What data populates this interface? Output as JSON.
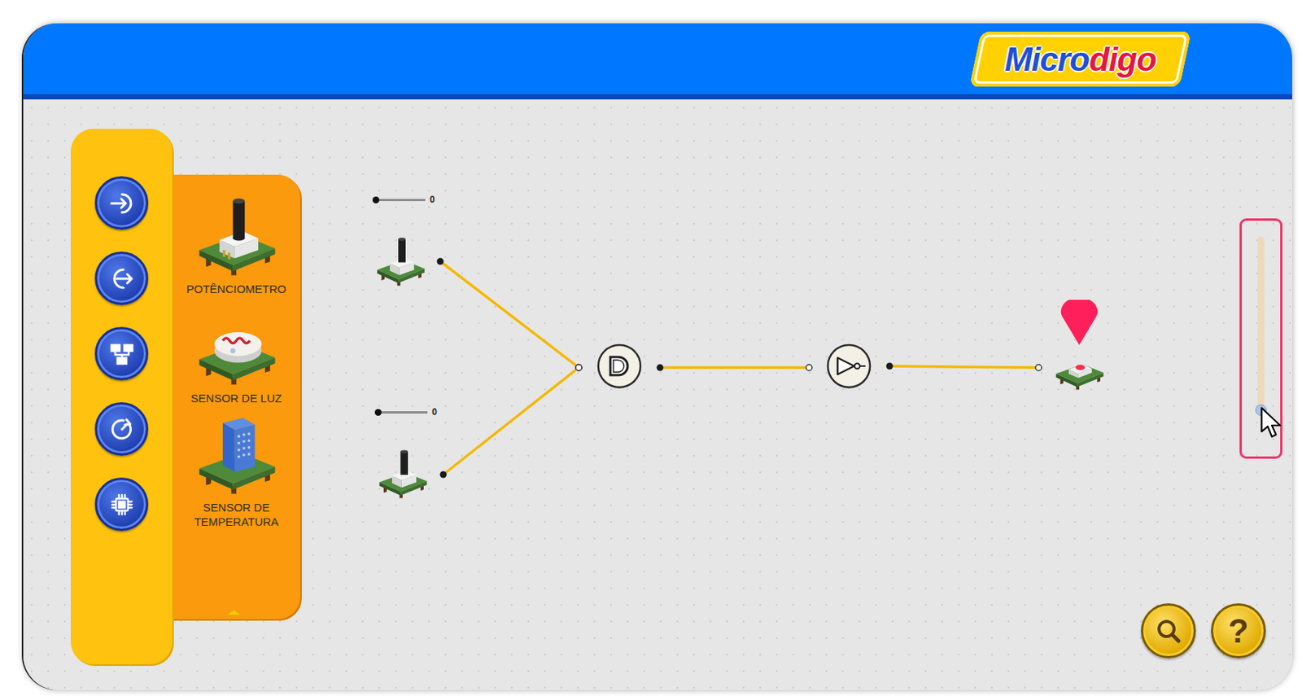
{
  "logo": [
    {
      "text": "Micro",
      "color": "#1f4fd8"
    },
    {
      "text": "digo",
      "color": "#e5173f"
    }
  ],
  "categories": [
    {
      "kind": "input"
    },
    {
      "kind": "output"
    },
    {
      "kind": "logic"
    },
    {
      "kind": "timer"
    },
    {
      "kind": "chip"
    }
  ],
  "palette": [
    {
      "label": "POTÊNCIOMETRO",
      "kind": "potentiometer"
    },
    {
      "label": "SENSOR DE LUZ",
      "kind": "light"
    },
    {
      "label": "SENSOR DE TEMPERATURA",
      "kind": "temperature"
    }
  ],
  "circuit": {
    "nodes": [
      {
        "kind": "potentiometer",
        "reading": "0",
        "level": 0
      },
      {
        "kind": "potentiometer",
        "reading": "0",
        "level": 0
      },
      {
        "kind": "and-gate"
      },
      {
        "kind": "not-gate"
      },
      {
        "kind": "led",
        "on": true
      }
    ]
  },
  "zoom": {
    "level": 0.02
  },
  "tools": [
    {
      "kind": "search"
    },
    {
      "kind": "help",
      "label": "?"
    }
  ]
}
